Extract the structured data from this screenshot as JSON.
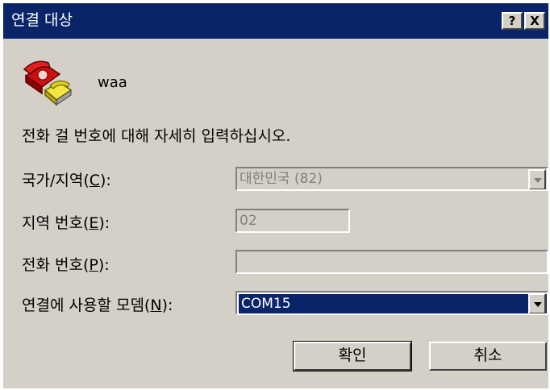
{
  "titlebar": {
    "title": "연결 대상",
    "help_label": "?",
    "close_label": "X"
  },
  "entry": {
    "name": "waa"
  },
  "instruction": "전화 걸 번호에 대해 자세히 입력하십시오.",
  "form": {
    "country_label_pre": "국가/지역(",
    "country_label_key": "C",
    "country_label_post": "):",
    "country_value": "대한민국 (82)",
    "area_label_pre": "지역 번호(",
    "area_label_key": "E",
    "area_label_post": "):",
    "area_value": "02",
    "phone_label_pre": "전화 번호(",
    "phone_label_key": "P",
    "phone_label_post": "):",
    "phone_value": "",
    "modem_label_pre": "연결에 사용할 모뎀(",
    "modem_label_key": "N",
    "modem_label_post": "):",
    "modem_value": "COM15"
  },
  "buttons": {
    "ok_label": "확인",
    "cancel_label": "취소"
  },
  "colors": {
    "titlebar": "#0a246a",
    "face": "#d4d0c8",
    "selection": "#0a246a"
  },
  "icons": {
    "entry_icon": "telephone-icon",
    "combo_icon": "chevron-down-icon"
  }
}
